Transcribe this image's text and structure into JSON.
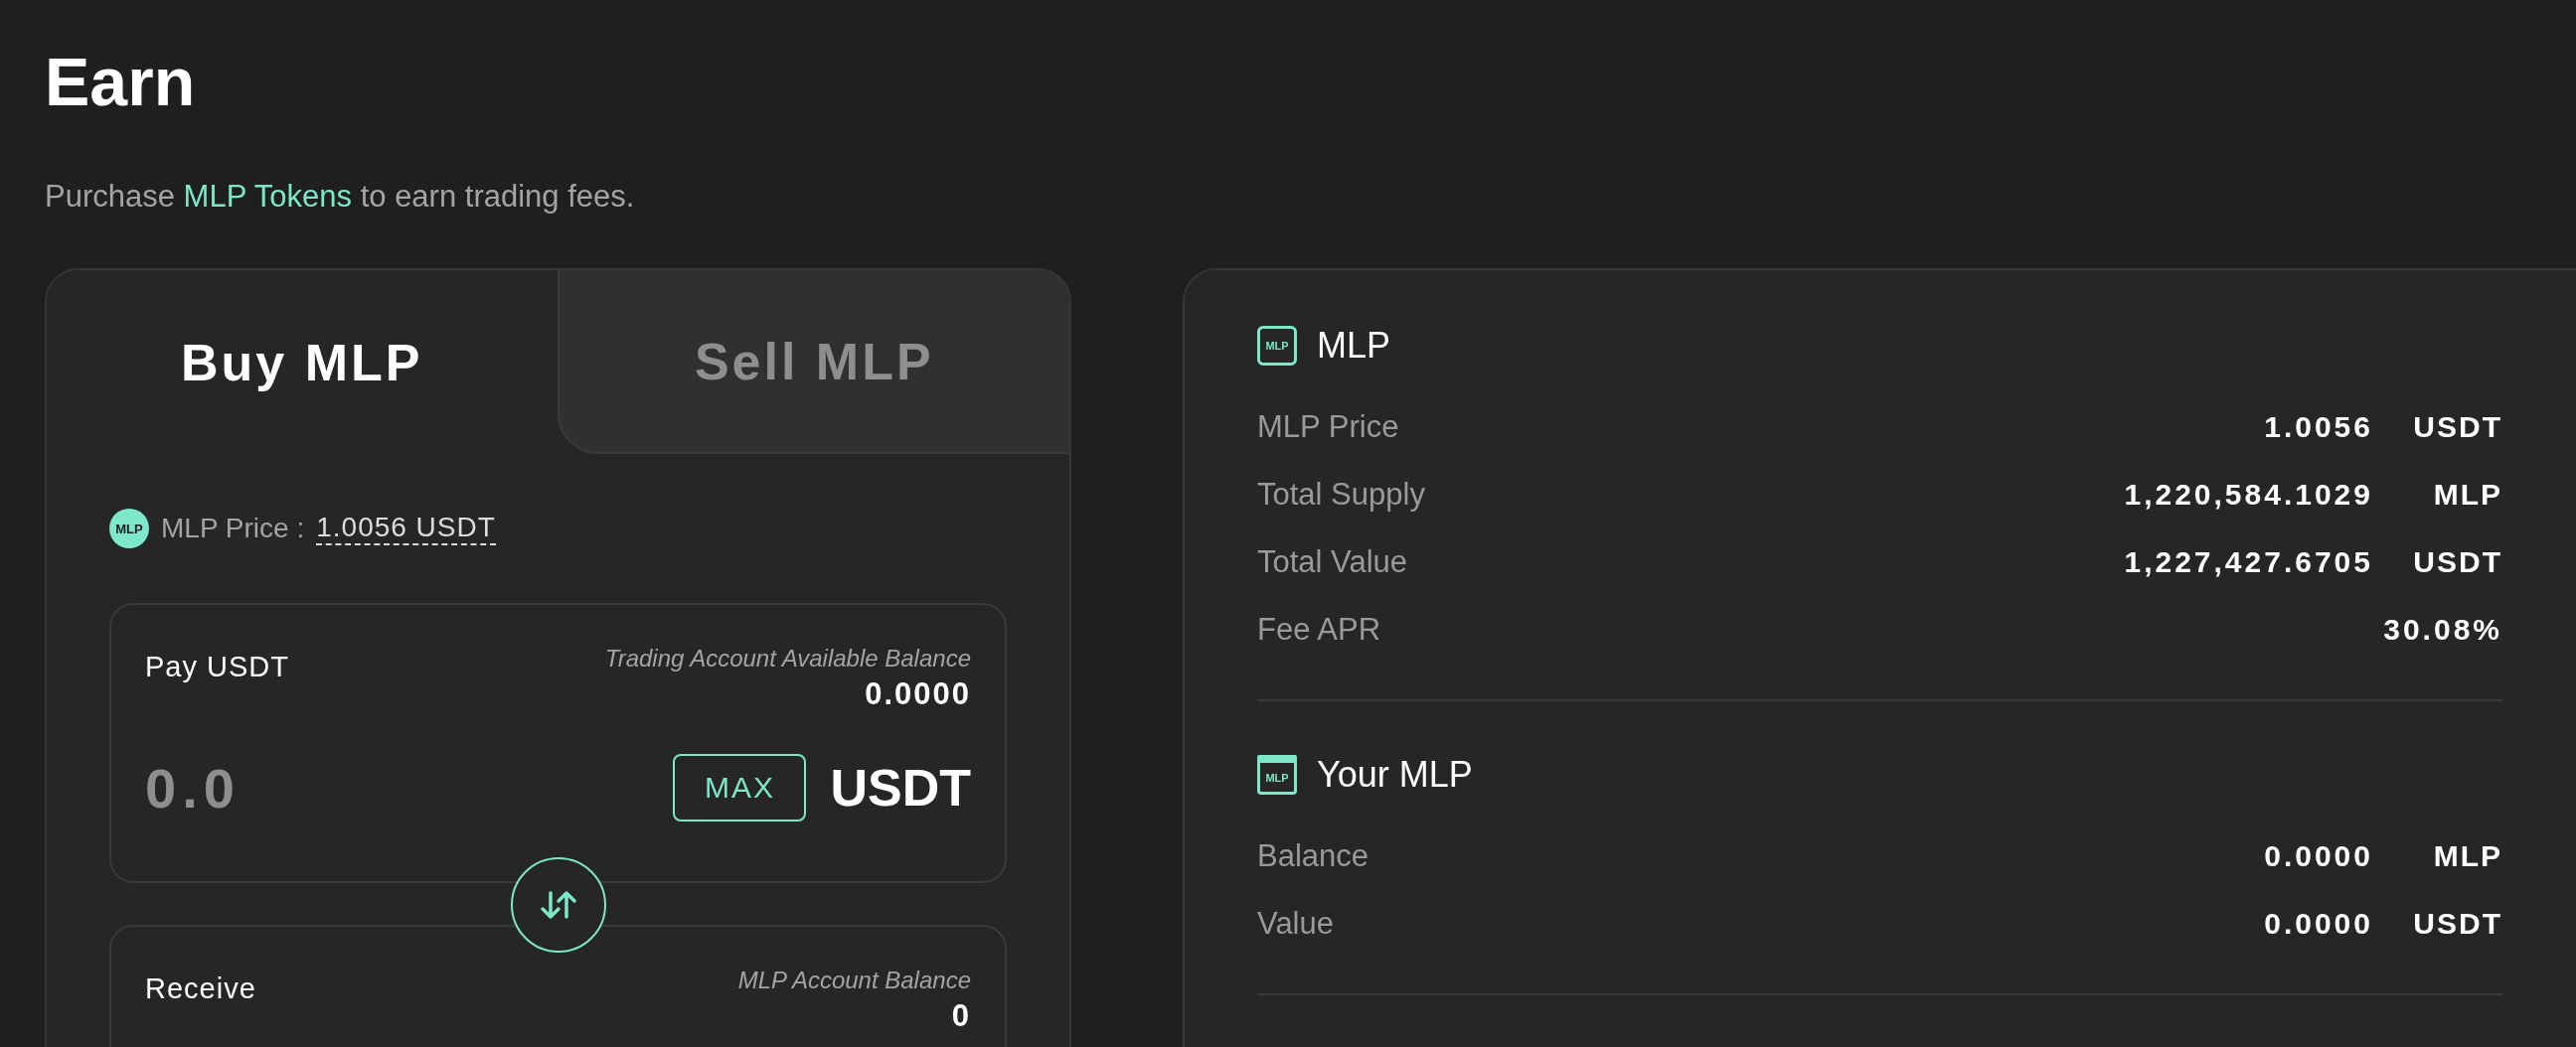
{
  "page": {
    "title": "Earn",
    "subtitle_before": "Purchase",
    "subtitle_link": "MLP Tokens",
    "subtitle_after": "to earn trading fees."
  },
  "tabs": [
    {
      "label": "Buy MLP",
      "selected": true
    },
    {
      "label": "Sell MLP",
      "selected": false
    }
  ],
  "price": {
    "badge": "MLP",
    "label": "MLP Price :",
    "value": "1.0056 USDT"
  },
  "pay": {
    "label": "Pay USDT",
    "balance_label": "Trading Account Available Balance",
    "balance": "0.0000",
    "placeholder": "0.0",
    "max_button": "MAX",
    "currency": "USDT"
  },
  "receive": {
    "label": "Receive",
    "balance_label": "MLP Account Balance",
    "balance": "0"
  },
  "sections": [
    {
      "badge": "MLP",
      "kind": "token",
      "title": "MLP",
      "rows": [
        {
          "label": "MLP Price",
          "value": "1.0056",
          "unit": "USDT"
        },
        {
          "label": "Total Supply",
          "value": "1,220,584.1029",
          "unit": "MLP"
        },
        {
          "label": "Total Value",
          "value": "1,227,427.6705",
          "unit": "USDT"
        },
        {
          "label": "Fee APR",
          "value": "30.08%"
        }
      ]
    },
    {
      "badge": "MLP",
      "kind": "box",
      "title": "Your MLP",
      "rows": [
        {
          "label": "Balance",
          "value": "0.0000",
          "unit": "MLP"
        },
        {
          "label": "Value",
          "value": "0.0000",
          "unit": "USDT"
        }
      ]
    }
  ]
}
